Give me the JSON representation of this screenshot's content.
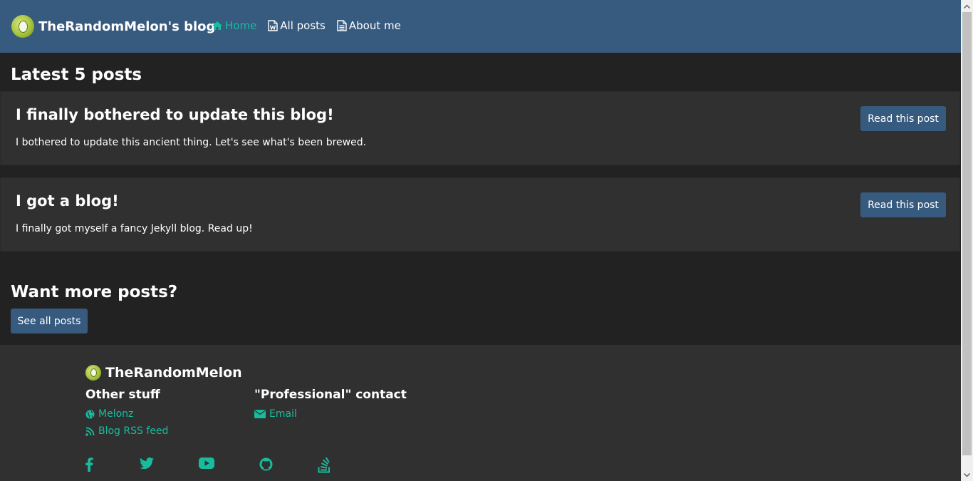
{
  "navbar": {
    "brand": "TheRandomMelon's blog",
    "links": [
      {
        "label": "Home",
        "icon": "home-icon",
        "active": true
      },
      {
        "label": "All posts",
        "icon": "word-file-icon",
        "active": false
      },
      {
        "label": "About me",
        "icon": "file-text-icon",
        "active": false
      }
    ]
  },
  "main": {
    "latest_heading": "Latest 5 posts",
    "posts": [
      {
        "title": "I finally bothered to update this blog!",
        "description": "I bothered to update this ancient thing. Let's see what's been brewed.",
        "button": "Read this post"
      },
      {
        "title": "I got a blog!",
        "description": "I finally got myself a fancy Jekyll blog. Read up!",
        "button": "Read this post"
      }
    ],
    "more_heading": "Want more posts?",
    "more_button": "See all posts"
  },
  "footer": {
    "brand": "TheRandomMelon",
    "other_heading": "Other stuff",
    "other_links": [
      {
        "label": "Melonz",
        "icon": "globe-icon"
      },
      {
        "label": "Blog RSS feed",
        "icon": "rss-icon"
      }
    ],
    "contact_heading": "\"Professional\" contact",
    "contact_links": [
      {
        "label": "Email",
        "icon": "envelope-icon"
      }
    ],
    "socials": [
      "facebook-icon",
      "twitter-icon",
      "youtube-icon",
      "github-icon",
      "stackoverflow-icon"
    ]
  },
  "colors": {
    "navbar_bg": "#375a7f",
    "body_bg": "#222222",
    "card_bg": "#303030",
    "accent": "#18bc9c",
    "button_bg": "#375a7f"
  }
}
